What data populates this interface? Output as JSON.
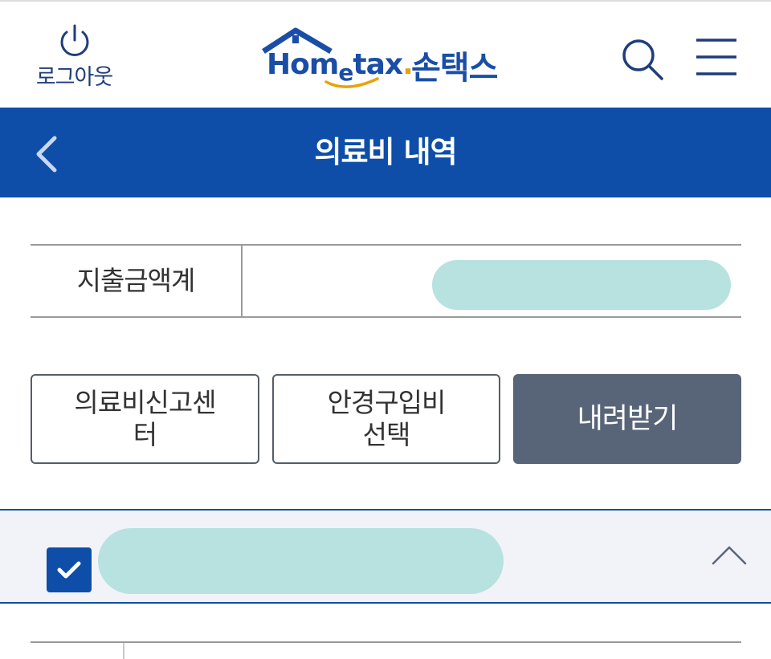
{
  "header": {
    "logout_label": "로그아웃",
    "logo_wordmark_main": "Hom",
    "logo_wordmark_e": "e",
    "logo_wordmark_tax": "tax",
    "logo_wordmark_dot": ".",
    "logo_son": "손택스",
    "icons": {
      "logout": "power-icon",
      "search": "search-icon",
      "menu": "hamburger-menu-icon"
    }
  },
  "titlebar": {
    "title": "의료비 내역",
    "back_icon": "chevron-left-icon"
  },
  "summary": {
    "label": "지출금액계",
    "value": ""
  },
  "actions": {
    "btn1_label": "의료비신고센\n터",
    "btn2_label": "안경구입비\n선택",
    "btn3_label": "내려받기"
  },
  "accordion": {
    "checked": true,
    "title": "",
    "icons": {
      "check": "checkmark-icon",
      "toggle": "chevron-up-icon"
    }
  },
  "colors": {
    "brand_blue": "#0e4ea8",
    "button_dark": "#586578",
    "accordion_bg": "#f2f3f8",
    "redaction": "#b7e2df",
    "logo_accent": "#e9a200"
  }
}
